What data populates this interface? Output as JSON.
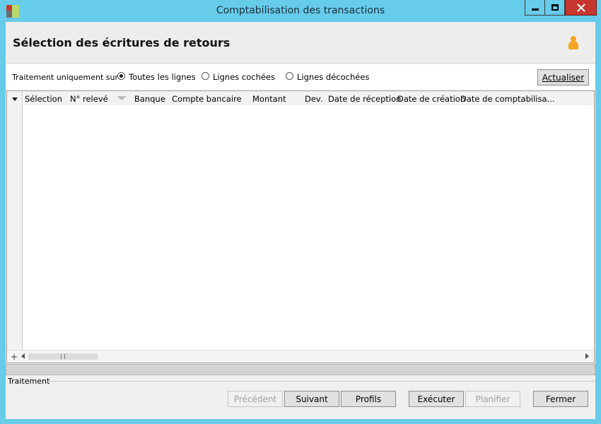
{
  "window": {
    "title": "Comptabilisation des transactions",
    "controls": {
      "minimize_icon": "minimize-icon",
      "maximize_icon": "maximize-icon",
      "close_icon": "close-x-icon"
    }
  },
  "header": {
    "title": "Sélection des écritures de retours",
    "user_icon": "user-icon"
  },
  "filter": {
    "label": "Traitement uniquement sur :",
    "options": [
      {
        "label": "Toutes les lignes",
        "selected": true
      },
      {
        "label": "Lignes cochées",
        "selected": false
      },
      {
        "label": "Lignes décochées",
        "selected": false
      }
    ],
    "refresh_button": "Actualiser"
  },
  "grid": {
    "columns": [
      "Sélection",
      "N° relevé",
      "Banque",
      "Compte bancaire",
      "Montant",
      "Dev.",
      "Date de réception",
      "Date de création",
      "Date de comptabilisa..."
    ],
    "rows": [],
    "add_symbol": "+"
  },
  "footer": {
    "section_label": "Traitement",
    "buttons": {
      "previous": "Précédent",
      "next": "Suivant",
      "profiles": "Profils",
      "execute": "Exécuter",
      "schedule": "Planifier",
      "close": "Fermer"
    }
  },
  "colors": {
    "title_bar": "#67cbea",
    "close_button": "#c7372f",
    "client_bg": "#f0f0f0",
    "user_icon": "#f5a623"
  }
}
